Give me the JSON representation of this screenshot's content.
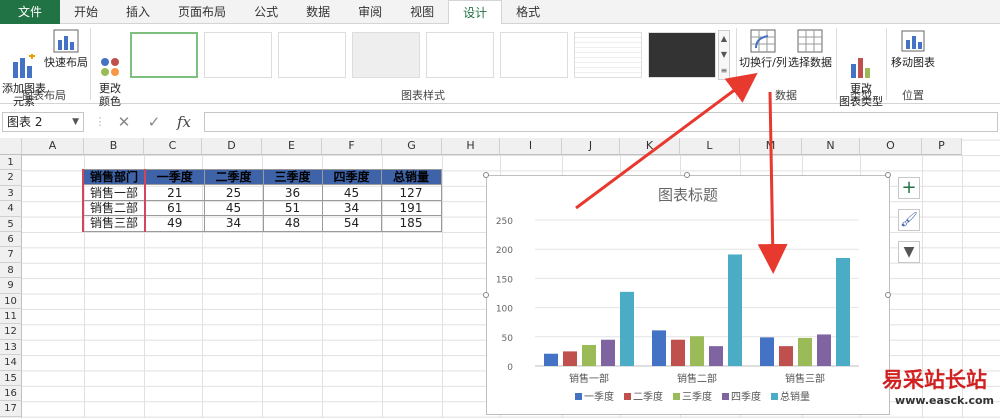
{
  "tabs": [
    "文件",
    "开始",
    "插入",
    "页面布局",
    "公式",
    "数据",
    "审阅",
    "视图",
    "设计",
    "格式"
  ],
  "active_tab": "设计",
  "ribbon": {
    "add_element": "添加图表\n元素",
    "quick_layout": "快速布局",
    "change_color": "更改\n颜色",
    "switch_row_col": "切换行/列",
    "select_data": "选择数据",
    "change_type": "更改\n图表类型",
    "move_chart": "移动图表",
    "groups": {
      "layout": "图表布局",
      "styles": "图表样式",
      "data": "数据",
      "type": "类型",
      "location": "位置"
    }
  },
  "name_box": "图表 2",
  "formula_icons": {
    "cancel": "✕",
    "enter": "✓",
    "fx": "fx"
  },
  "columns": [
    "A",
    "B",
    "C",
    "D",
    "E",
    "F",
    "G",
    "H",
    "I",
    "J",
    "K",
    "L",
    "M",
    "N",
    "O",
    "P"
  ],
  "rows": [
    "1",
    "2",
    "3",
    "4",
    "5",
    "6",
    "7",
    "8",
    "9",
    "10",
    "11",
    "12",
    "13",
    "14",
    "15",
    "16",
    "17",
    "18"
  ],
  "table": {
    "headers": [
      "销售部门",
      "一季度",
      "二季度",
      "三季度",
      "四季度",
      "总销量"
    ],
    "rows": [
      {
        "dept": "销售一部",
        "values": [
          "21",
          "25",
          "36",
          "45",
          "127"
        ]
      },
      {
        "dept": "销售二部",
        "values": [
          "61",
          "45",
          "51",
          "34",
          "191"
        ]
      },
      {
        "dept": "销售三部",
        "values": [
          "49",
          "34",
          "48",
          "54",
          "185"
        ]
      }
    ]
  },
  "chart_data": {
    "type": "bar",
    "title": "图表标题",
    "categories": [
      "销售一部",
      "销售二部",
      "销售三部"
    ],
    "series": [
      {
        "name": "一季度",
        "values": [
          21,
          61,
          49
        ],
        "color": "#4472c4"
      },
      {
        "name": "二季度",
        "values": [
          25,
          45,
          34
        ],
        "color": "#c0504d"
      },
      {
        "name": "三季度",
        "values": [
          36,
          51,
          48
        ],
        "color": "#9bbb59"
      },
      {
        "name": "四季度",
        "values": [
          45,
          34,
          54
        ],
        "color": "#8064a2"
      },
      {
        "name": "总销量",
        "values": [
          127,
          191,
          185
        ],
        "color": "#4bacc6"
      }
    ],
    "ylim": [
      0,
      250
    ],
    "yticks": [
      "0",
      "50",
      "100",
      "150",
      "200",
      "250"
    ],
    "grid": true,
    "legend": "bottom"
  },
  "chart_side_buttons": {
    "elements": "plus-icon",
    "styles": "brush-icon",
    "filter": "filter-icon"
  },
  "watermark": {
    "text": "易采站长站",
    "url": "www.easck.com"
  },
  "colors": {
    "accent": "#217346",
    "header_fill": "#3e63a8",
    "arrow": "#e8392f"
  }
}
